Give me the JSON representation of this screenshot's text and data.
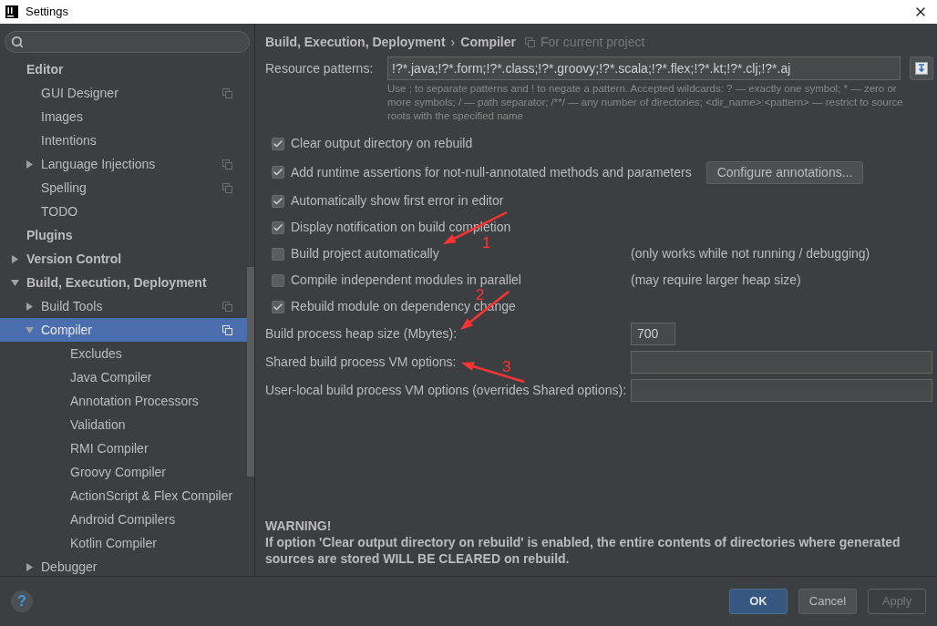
{
  "window": {
    "title": "Settings"
  },
  "sidebar": {
    "tree": [
      {
        "label": "Editor",
        "selected": false,
        "per_project": false,
        "children": [
          {
            "label": "GUI Designer",
            "selected": false,
            "per_project": true
          },
          {
            "label": "Images",
            "selected": false,
            "per_project": false
          },
          {
            "label": "Intentions",
            "selected": false,
            "per_project": false
          },
          {
            "label": "Language Injections",
            "selected": false,
            "per_project": true,
            "expanded": false
          },
          {
            "label": "Spelling",
            "selected": false,
            "per_project": true
          },
          {
            "label": "TODO",
            "selected": false,
            "per_project": false
          }
        ]
      },
      {
        "label": "Plugins",
        "selected": false,
        "per_project": false
      },
      {
        "label": "Version Control",
        "selected": false,
        "per_project": false,
        "expanded": false
      },
      {
        "label": "Build, Execution, Deployment",
        "selected": false,
        "per_project": false,
        "expanded": true,
        "children": [
          {
            "label": "Build Tools",
            "selected": false,
            "per_project": true,
            "expanded": false
          },
          {
            "label": "Compiler",
            "selected": true,
            "per_project": true,
            "expanded": true,
            "children": [
              {
                "label": "Excludes",
                "selected": false,
                "per_project": false
              },
              {
                "label": "Java Compiler",
                "selected": false,
                "per_project": false
              },
              {
                "label": "Annotation Processors",
                "selected": false,
                "per_project": false
              },
              {
                "label": "Validation",
                "selected": false,
                "per_project": false
              },
              {
                "label": "RMI Compiler",
                "selected": false,
                "per_project": false
              },
              {
                "label": "Groovy Compiler",
                "selected": false,
                "per_project": false
              },
              {
                "label": "ActionScript & Flex Compiler",
                "selected": false,
                "per_project": false
              },
              {
                "label": "Android Compilers",
                "selected": false,
                "per_project": false
              },
              {
                "label": "Kotlin Compiler",
                "selected": false,
                "per_project": false
              }
            ]
          },
          {
            "label": "Debugger",
            "selected": false,
            "per_project": false,
            "expanded": false
          }
        ]
      }
    ]
  },
  "breadcrumb": {
    "parent": "Build, Execution, Deployment",
    "separator": "›",
    "current": "Compiler",
    "scope": "For current project"
  },
  "resource_patterns": {
    "label": "Resource patterns:",
    "value": "!?*.java;!?*.form;!?*.class;!?*.groovy;!?*.scala;!?*.flex;!?*.kt;!?*.clj;!?*.aj",
    "hint": "Use ; to separate patterns and ! to negate a pattern. Accepted wildcards: ? — exactly one symbol; * — zero or more symbols; / — path separator; /**/ — any number of directories;  <dir_name>:<pattern> — restrict to source roots with the specified name"
  },
  "options": [
    {
      "label": "Clear output directory on rebuild",
      "checked": true
    },
    {
      "label": "Add runtime assertions for not-null-annotated methods and parameters",
      "checked": true,
      "button": "Configure annotations..."
    },
    {
      "label": "Automatically show first error in editor",
      "checked": true
    },
    {
      "label": "Display notification on build completion",
      "checked": true
    },
    {
      "label": "Build project automatically",
      "checked": false,
      "note": "(only works while not running / debugging)"
    },
    {
      "label": "Compile independent modules in parallel",
      "checked": false,
      "note": "(may require larger heap size)"
    },
    {
      "label": "Rebuild module on dependency change",
      "checked": true
    }
  ],
  "fields": [
    {
      "label": "Build process heap size (Mbytes):",
      "value": "700",
      "kind": "short"
    },
    {
      "label": "Shared build process VM options:",
      "kind": "wide"
    },
    {
      "label": "User-local build process VM options (overrides Shared options):",
      "kind": "wide"
    }
  ],
  "warning": {
    "title": "WARNING!",
    "text": "If option 'Clear output directory on rebuild' is enabled, the entire contents of directories where generated sources are stored WILL BE CLEARED on rebuild."
  },
  "annotations": [
    {
      "label": "1"
    },
    {
      "label": "2"
    },
    {
      "label": "3"
    }
  ],
  "help": "?",
  "buttons": [
    {
      "label": "OK",
      "kind": "default"
    },
    {
      "label": "Cancel",
      "kind": "normal"
    },
    {
      "label": "Apply",
      "kind": "disabled"
    }
  ]
}
